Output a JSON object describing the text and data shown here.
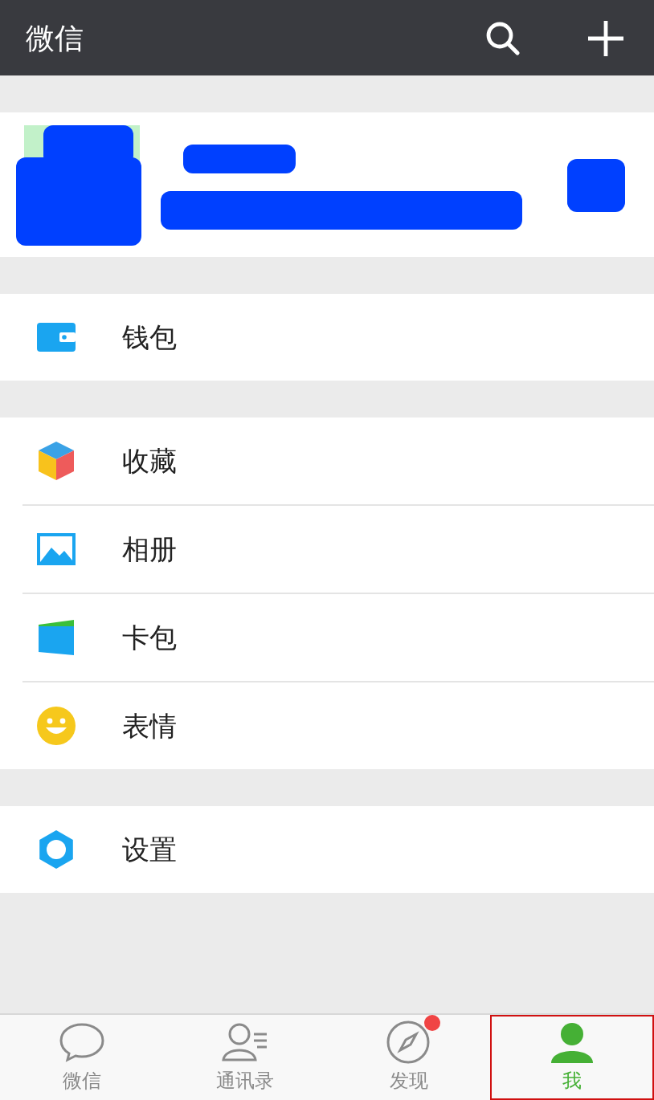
{
  "header": {
    "title": "微信"
  },
  "groups": [
    {
      "items": [
        {
          "label": "钱包",
          "kind": "wallet"
        }
      ]
    },
    {
      "items": [
        {
          "label": "收藏",
          "kind": "cube"
        },
        {
          "label": "相册",
          "kind": "photo"
        },
        {
          "label": "卡包",
          "kind": "card"
        },
        {
          "label": "表情",
          "kind": "smile"
        }
      ]
    },
    {
      "items": [
        {
          "label": "设置",
          "kind": "gear"
        }
      ]
    }
  ],
  "tabs": [
    {
      "label": "微信",
      "kind": "chat",
      "selected": false,
      "badge": false
    },
    {
      "label": "通讯录",
      "kind": "contacts",
      "selected": false,
      "badge": false
    },
    {
      "label": "发现",
      "kind": "compass",
      "selected": false,
      "badge": true
    },
    {
      "label": "我",
      "kind": "person",
      "selected": true,
      "badge": false
    }
  ]
}
